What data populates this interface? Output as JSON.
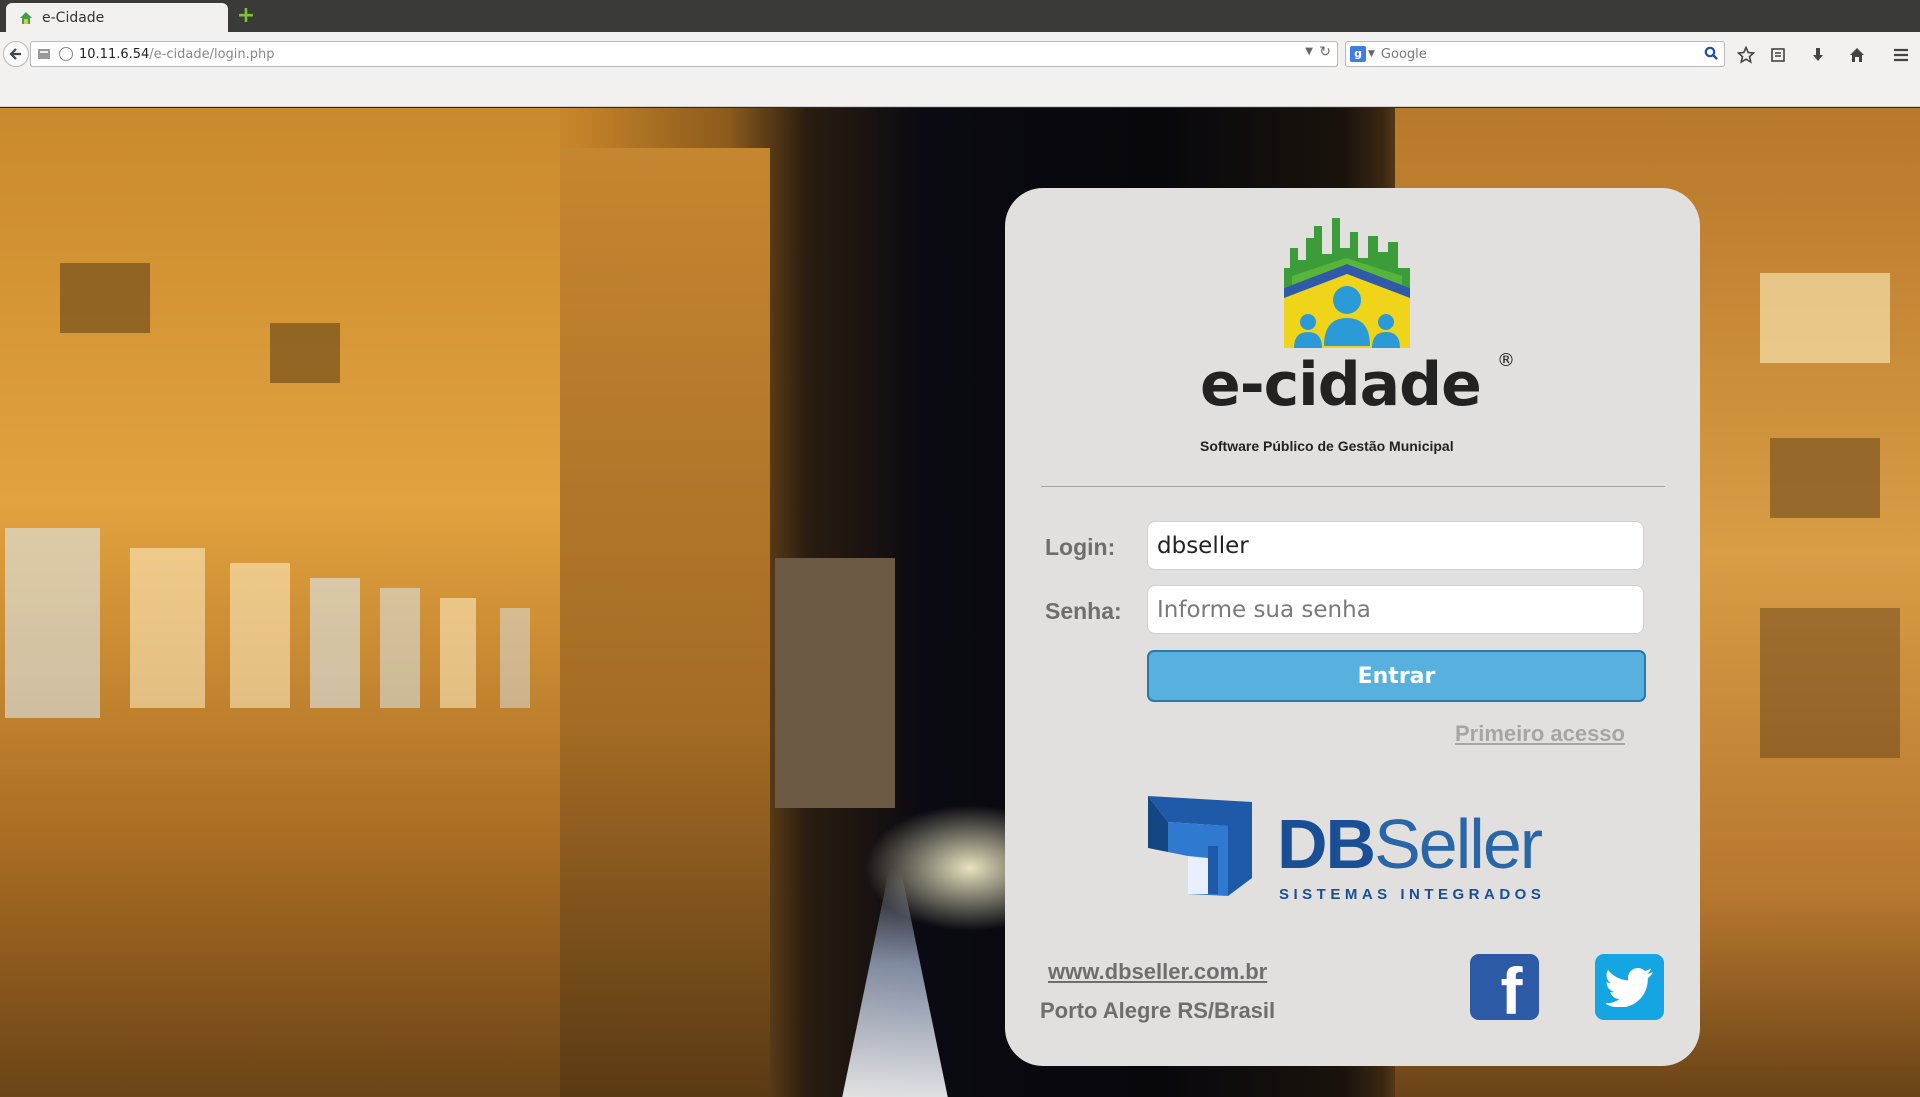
{
  "browser": {
    "tab_title": "e-Cidade",
    "url_host": "10.11.6.54",
    "url_path": "/e-cidade/login.php",
    "search_placeholder": "Google"
  },
  "logo": {
    "title": "e-cidade",
    "registered": "®",
    "subtitle": "Software Público de Gestão Municipal"
  },
  "form": {
    "login_label": "Login:",
    "login_value": "dbseller",
    "password_label": "Senha:",
    "password_placeholder": "Informe sua senha",
    "submit_label": "Entrar",
    "first_access_label": "Primeiro acesso"
  },
  "footer": {
    "db": "DB",
    "seller": "Seller",
    "company_tagline": "SISTEMAS INTEGRADOS",
    "website": "www.dbseller.com.br",
    "location": "Porto Alegre RS/Brasil",
    "facebook_glyph": "f"
  },
  "colors": {
    "card_bg": "#e2e0df",
    "button_bg": "#58b0df",
    "brand_blue": "#1a4f95",
    "facebook": "#2d5aa6",
    "twitter": "#16a5e3"
  },
  "icons": [
    "home-favicon",
    "new-tab-icon",
    "back-arrow-icon",
    "site-identity-icon",
    "reload-icon",
    "search-engine-icon",
    "magnifier-icon",
    "bookmark-star-icon",
    "bookmarks-list-icon",
    "download-icon",
    "home-icon",
    "menu-icon",
    "facebook-icon",
    "twitter-icon"
  ]
}
